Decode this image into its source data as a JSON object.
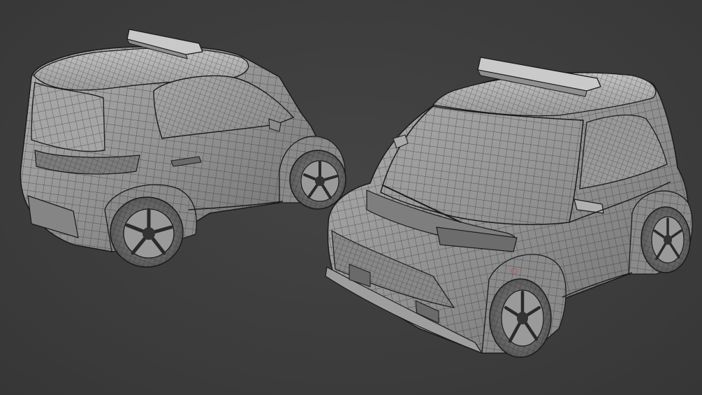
{
  "scene": {
    "background_color": "#3d3d3d",
    "surface_color": "#9a9a9a",
    "wire_color": "#1e1e1e",
    "objects": [
      {
        "name": "compact-police-car-rear-view",
        "lightbar": true
      },
      {
        "name": "compact-police-car-front-view",
        "lightbar": true
      }
    ]
  }
}
